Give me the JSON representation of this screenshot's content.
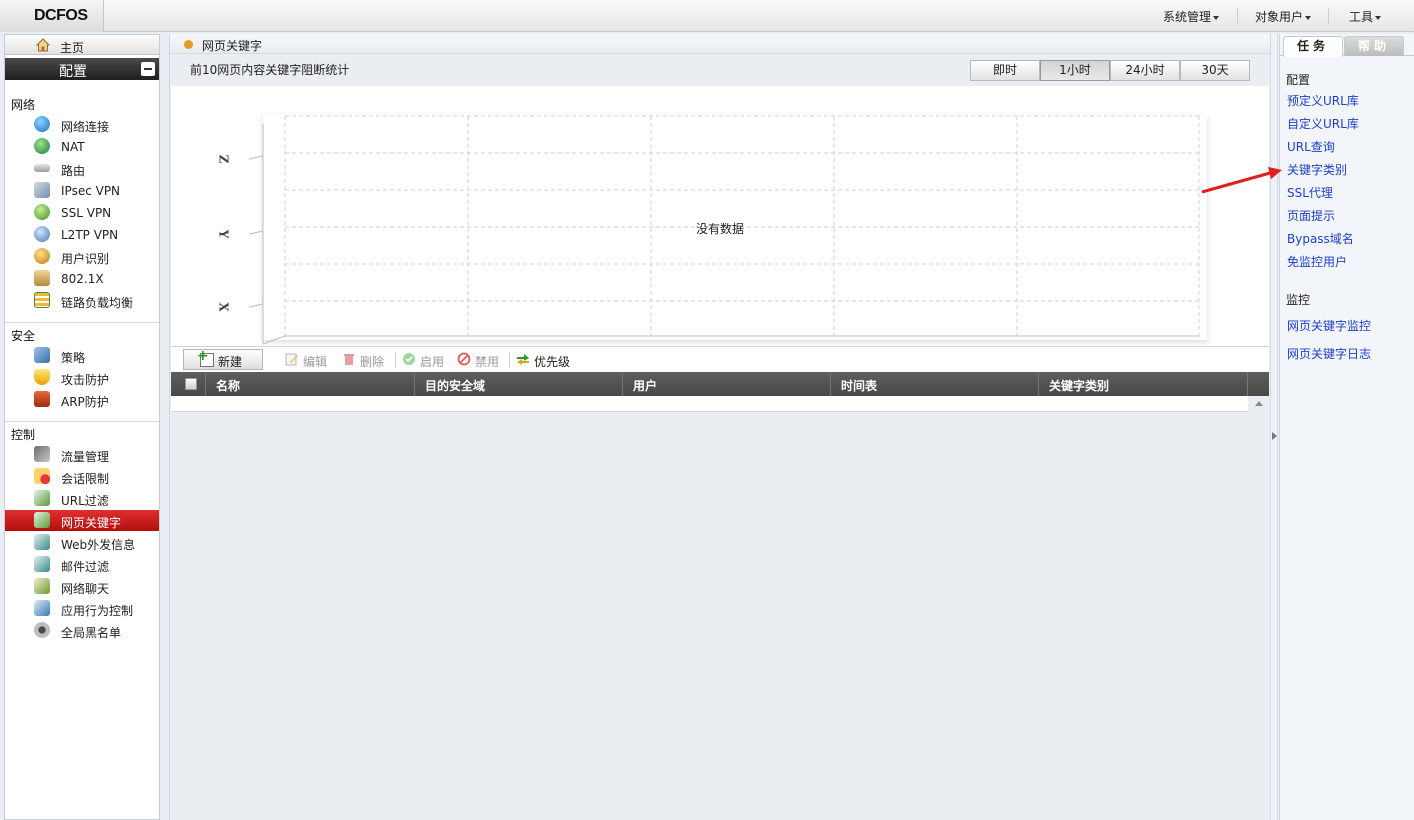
{
  "topbar": {
    "logo": "DCFOS",
    "menus": [
      {
        "label": "系统管理"
      },
      {
        "label": "对象用户"
      },
      {
        "label": "工具"
      }
    ]
  },
  "sidebar": {
    "home_label": "主页",
    "config_label": "配置",
    "sections": [
      {
        "title": "网络",
        "items": [
          {
            "label": "网络连接",
            "icon": "globe-icon"
          },
          {
            "label": "NAT",
            "icon": "nat-icon"
          },
          {
            "label": "路由",
            "icon": "router-icon"
          },
          {
            "label": "IPsec VPN",
            "icon": "ipsec-vpn-icon"
          },
          {
            "label": "SSL VPN",
            "icon": "ssl-vpn-icon"
          },
          {
            "label": "L2TP VPN",
            "icon": "l2tp-vpn-icon"
          },
          {
            "label": "用户识别",
            "icon": "user-identify-icon"
          },
          {
            "label": "802.1X",
            "icon": "8021x-icon"
          },
          {
            "label": "链路负载均衡",
            "icon": "link-balance-icon"
          }
        ]
      },
      {
        "title": "安全",
        "items": [
          {
            "label": "策略",
            "icon": "policy-icon"
          },
          {
            "label": "攻击防护",
            "icon": "shield-icon"
          },
          {
            "label": "ARP防护",
            "icon": "arp-icon"
          }
        ]
      },
      {
        "title": "控制",
        "items": [
          {
            "label": "流量管理",
            "icon": "traffic-icon"
          },
          {
            "label": "会话限制",
            "icon": "session-limit-icon"
          },
          {
            "label": "URL过滤",
            "icon": "url-filter-icon"
          },
          {
            "label": "网页关键字",
            "icon": "web-keyword-icon",
            "active": true
          },
          {
            "label": "Web外发信息",
            "icon": "web-outbound-icon"
          },
          {
            "label": "邮件过滤",
            "icon": "mail-filter-icon"
          },
          {
            "label": "网络聊天",
            "icon": "chat-icon"
          },
          {
            "label": "应用行为控制",
            "icon": "app-control-icon"
          },
          {
            "label": "全局黑名单",
            "icon": "blacklist-icon"
          }
        ]
      }
    ]
  },
  "main": {
    "breadcrumb": "网页关键字",
    "subtitle": "前10网页内容关键字阻断统计",
    "range_buttons": [
      {
        "label": "即时"
      },
      {
        "label": "1小时",
        "selected": true
      },
      {
        "label": "24小时"
      },
      {
        "label": "30天"
      }
    ],
    "chart": {
      "no_data": "没有数据",
      "axis_labels": [
        "Z",
        "Y",
        "X"
      ]
    },
    "toolbar": {
      "new": "新建",
      "edit": "编辑",
      "delete": "删除",
      "enable": "启用",
      "disable": "禁用",
      "priority": "优先级"
    },
    "table": {
      "columns": [
        "名称",
        "目的安全域",
        "用户",
        "时间表",
        "关键字类别"
      ],
      "rows": []
    }
  },
  "right_panel": {
    "tabs": [
      "任务",
      "帮助"
    ],
    "sections": [
      {
        "title": "配置",
        "links": [
          "预定义URL库",
          "自定义URL库",
          "URL查询",
          "关键字类别",
          "SSL代理",
          "页面提示",
          "Bypass域名",
          "免监控用户"
        ]
      },
      {
        "title": "监控",
        "links": [
          "网页关键字监控",
          "网页关键字日志"
        ]
      }
    ]
  },
  "colors": {
    "active_nav": "#c8161c",
    "link": "#1f3ec9",
    "header_dark": "#4a4a4a",
    "annotation_arrow": "#e02020"
  }
}
